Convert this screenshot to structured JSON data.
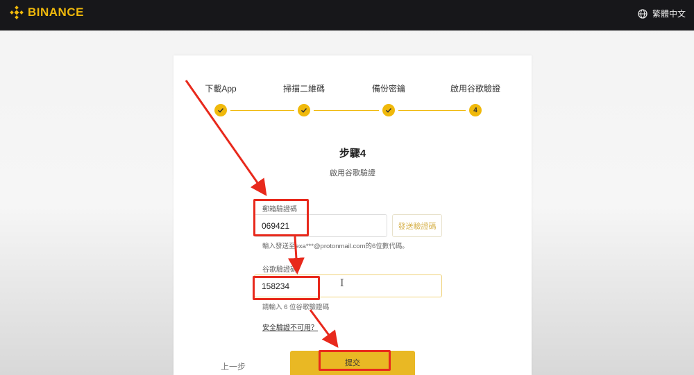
{
  "header": {
    "brand": "BINANCE",
    "language": "繁體中文"
  },
  "steps": [
    {
      "label": "下載App",
      "marker": "check"
    },
    {
      "label": "掃描二維碼",
      "marker": "check"
    },
    {
      "label": "備份密鑰",
      "marker": "check"
    },
    {
      "label": "啟用谷歌驗證",
      "marker": "4"
    }
  ],
  "main": {
    "title": "步驟4",
    "subtitle": "啟用谷歌驗證"
  },
  "email_code": {
    "label": "郵箱驗證碼",
    "value": "069421",
    "send_button": "發送驗證碼",
    "hint": "輸入發送至exa***@protonmail.com的6位數代碼。"
  },
  "google_code": {
    "label": "谷歌驗證碼",
    "value": "158234",
    "hint": "請輸入 6 位谷歌驗證碼"
  },
  "security_link": "安全驗證不可用？",
  "footer": {
    "back": "上一步",
    "submit": "提交"
  },
  "colors": {
    "brand": "#f0b90b",
    "annotation": "#e8291c"
  }
}
